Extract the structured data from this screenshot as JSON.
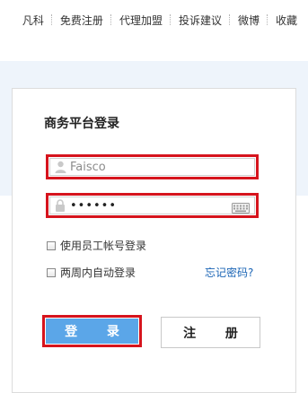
{
  "topnav": {
    "items": [
      "凡科",
      "免费注册",
      "代理加盟",
      "投诉建议",
      "微博",
      "收藏"
    ]
  },
  "login": {
    "title": "商务平台登录",
    "username": {
      "value": "Faisco",
      "icon": "user-icon"
    },
    "password": {
      "value": "••••••",
      "icon": "lock-icon",
      "keyboard_icon": "keyboard-icon"
    },
    "options": {
      "employee_login": "使用员工帐号登录",
      "auto_login": "两周内自动登录",
      "employee_checked": false,
      "auto_checked": false
    },
    "forgot_password": "忘记密码?",
    "login_button": "登 录",
    "register_button": "注 册"
  },
  "colors": {
    "highlight": "#d6141d",
    "login_button": "#5ba6e8",
    "link": "#1a64b5",
    "banner": "#eef4fb"
  }
}
